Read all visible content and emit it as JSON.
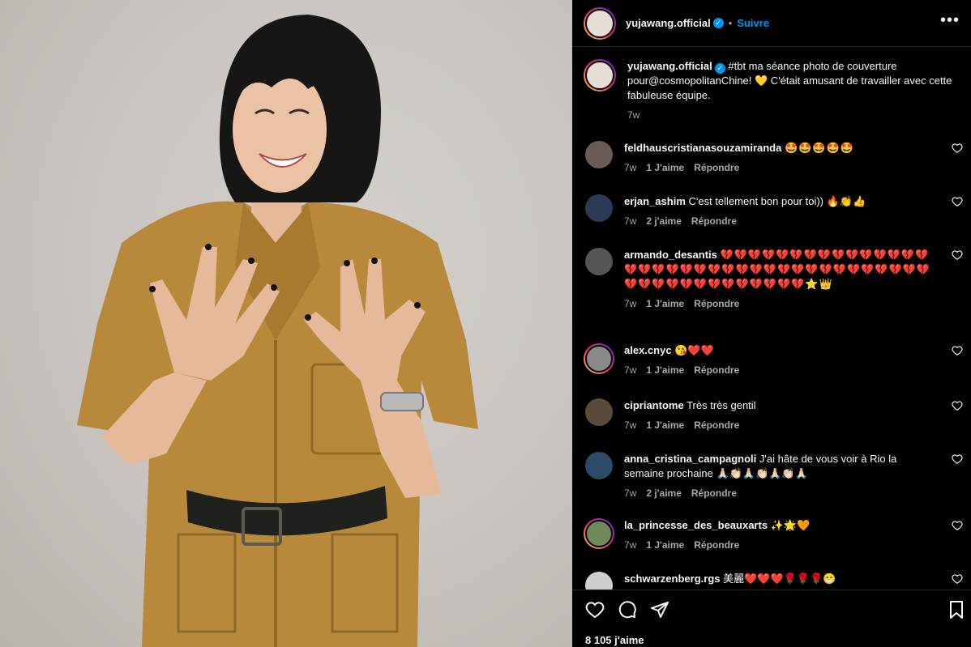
{
  "post": {
    "username": "yujawang.official",
    "follow_label": "Suivre",
    "more_label": "•••",
    "caption_prefix": "#tbt ma séance photo de couverture pour@cosmopolitanChine! 💛 C'était amusant de travailler avec cette fabuleuse équipe.",
    "caption_time": "7w",
    "likes": "8 105 j'aime"
  },
  "comments": [
    {
      "user": "feldhauscristianasouzamiranda",
      "text": "🤩🤩🤩🤩🤩",
      "time": "7w",
      "likes": "1 J'aime",
      "reply": "Répondre",
      "ring": false,
      "color": "#6b5a55"
    },
    {
      "user": "erjan_ashim",
      "text": "C'est tellement bon pour toi)) 🔥👏👍",
      "time": "7w",
      "likes": "2 j'aime",
      "reply": "Répondre",
      "ring": false,
      "color": "#2b3b55"
    },
    {
      "user": "armando_desantis",
      "text": "💔💔💔💔💔💔💔💔💔💔💔💔💔💔💔💔💔💔💔💔💔💔💔💔💔💔💔💔💔💔💔💔💔💔💔💔💔💔💔💔💔💔💔💔💔💔💔💔💔💔⭐👑",
      "time": "7w",
      "likes": "1 J'aime",
      "reply": "Répondre",
      "ring": false,
      "color": "#555"
    },
    {
      "user": "alex.cnyc",
      "text": "😘❤️❤️",
      "time": "7w",
      "likes": "1 J'aime",
      "reply": "Répondre",
      "ring": true,
      "color": "#8a8a8a"
    },
    {
      "user": "cipriantome",
      "text": "Très très gentil",
      "time": "7w",
      "likes": "1 J'aime",
      "reply": "Répondre",
      "ring": false,
      "color": "#5a4a3a"
    },
    {
      "user": "anna_cristina_campagnoli",
      "text": "J'ai hâte de vous voir à Rio la semaine prochaine 🙏🏻👏🏻🙏🏻👏🏻🙏🏻👏🏻🙏🏻",
      "time": "7w",
      "likes": "2 j'aime",
      "reply": "Répondre",
      "ring": false,
      "color": "#2d4a66"
    },
    {
      "user": "la_princesse_des_beauxarts",
      "text": "✨🌟🧡",
      "time": "7w",
      "likes": "1 J'aime",
      "reply": "Répondre",
      "ring": true,
      "color": "#6f8a5a"
    },
    {
      "user": "schwarzenberg.rgs",
      "text": "美麗❤️❤️❤️🌹🌹🌹😁",
      "time": "",
      "likes": "",
      "reply": "",
      "ring": false,
      "color": "#cfcfcf"
    }
  ],
  "icons": {
    "like": "heart-icon",
    "comment": "comment-icon",
    "share": "send-icon",
    "save": "bookmark-icon"
  },
  "colors": {
    "accent": "#0095f6",
    "background": "#000000",
    "secondary_text": "#a8a8a8",
    "jumpsuit": "#b8893a"
  }
}
